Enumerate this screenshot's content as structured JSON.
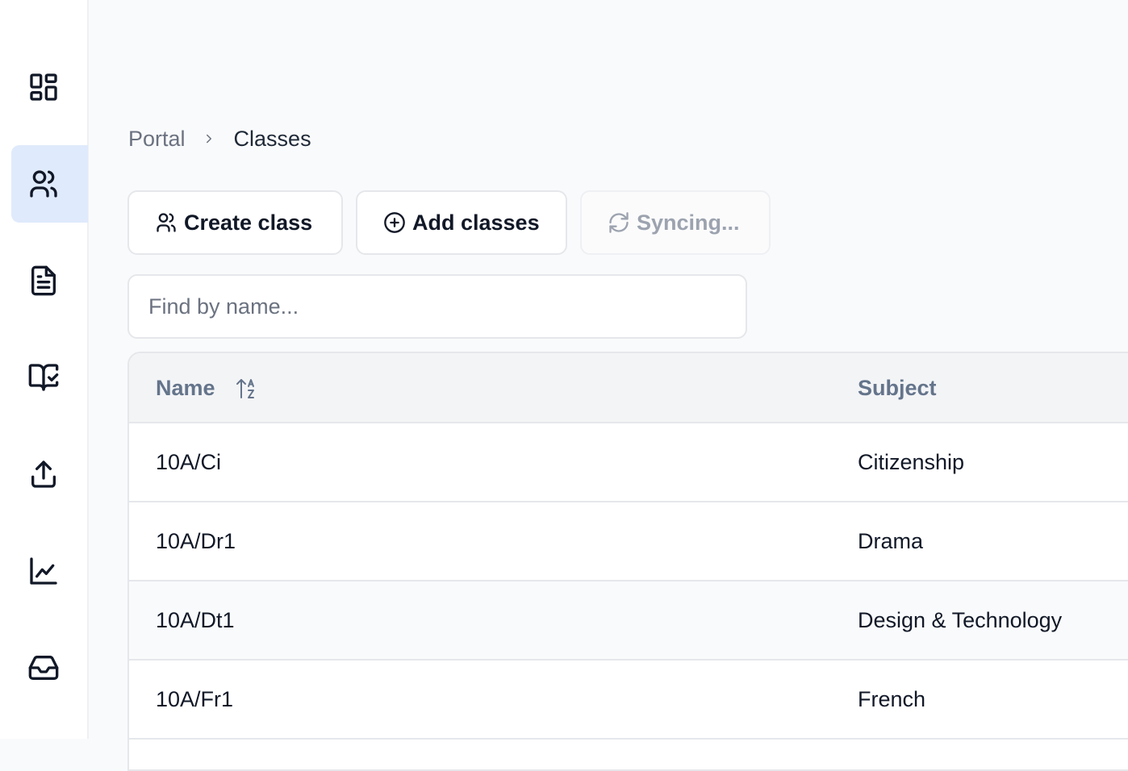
{
  "sidebar": {
    "items": [
      {
        "icon": "dashboard-icon",
        "active": false
      },
      {
        "icon": "users-icon",
        "active": true
      },
      {
        "icon": "document-icon",
        "active": false
      },
      {
        "icon": "book-check-icon",
        "active": false
      },
      {
        "icon": "upload-icon",
        "active": false
      },
      {
        "icon": "chart-icon",
        "active": false
      },
      {
        "icon": "inbox-icon",
        "active": false
      }
    ]
  },
  "breadcrumb": {
    "parent": "Portal",
    "current": "Classes"
  },
  "toolbar": {
    "create_label": "Create class",
    "add_label": "Add classes",
    "sync_label": "Syncing..."
  },
  "search": {
    "placeholder": "Find by name...",
    "value": ""
  },
  "table": {
    "columns": [
      "Name",
      "Subject"
    ],
    "rows": [
      {
        "name": "10A/Ci",
        "subject": "Citizenship"
      },
      {
        "name": "10A/Dr1",
        "subject": "Drama"
      },
      {
        "name": "10A/Dt1",
        "subject": "Design & Technology"
      },
      {
        "name": "10A/Fr1",
        "subject": "French"
      }
    ]
  },
  "colors": {
    "accent_bg": "#dfeafc",
    "muted_text": "#6b7280",
    "header_text": "#64748b",
    "border": "#e5e7eb"
  }
}
